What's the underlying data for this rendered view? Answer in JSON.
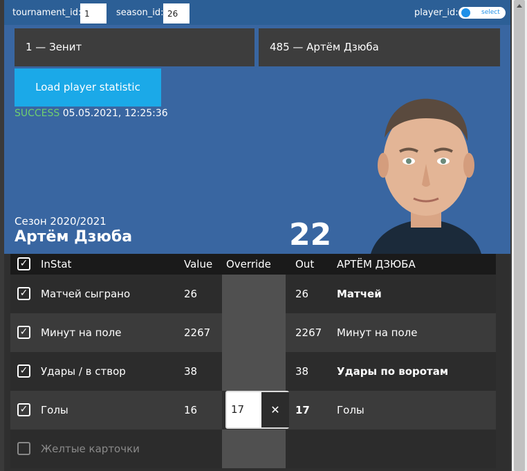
{
  "topbar": {
    "tournament_label": "tournament_id:",
    "tournament_value": "1",
    "season_label": "season_id:",
    "season_value": "26",
    "player_label": "player_id:",
    "player_toggle_text": "select"
  },
  "selectors": {
    "team": "1 — Зенит",
    "player": "485 — Артём Дзюба"
  },
  "load_button": "Load player statistic",
  "status": {
    "result": "SUCCESS",
    "timestamp": "05.05.2021, 12:25:36"
  },
  "player": {
    "season": "Сезон 2020/2021",
    "name": "Артём Дзюба",
    "number": "22"
  },
  "table": {
    "headers": {
      "instat": "InStat",
      "value": "Value",
      "override": "Override",
      "out": "Out",
      "player_col": "АРТЁМ ДЗЮБА"
    },
    "rows": [
      {
        "label": "Матчей сыграно",
        "value": "26",
        "override": "",
        "out": "26",
        "out_label": "Матчей",
        "checked": true
      },
      {
        "label": "Минут на поле",
        "value": "2267",
        "override": "",
        "out": "2267",
        "out_label": "Минут на поле",
        "checked": true
      },
      {
        "label": "Удары / в створ",
        "value": "38",
        "override": "",
        "out": "38",
        "out_label": "Удары по воротам",
        "checked": true
      },
      {
        "label": "Голы",
        "value": "16",
        "override": "17",
        "out": "17",
        "out_label": "Голы",
        "checked": true
      },
      {
        "label": "Желтые карточки",
        "value": "",
        "override": "",
        "out": "",
        "out_label": "",
        "checked": false
      }
    ]
  },
  "icons": {
    "check": "✓",
    "clear": "✕"
  },
  "colors": {
    "topbar": "#2c5f96",
    "panel": "#3966a1",
    "accent": "#1ba9e8",
    "success": "#6fcf6f"
  }
}
